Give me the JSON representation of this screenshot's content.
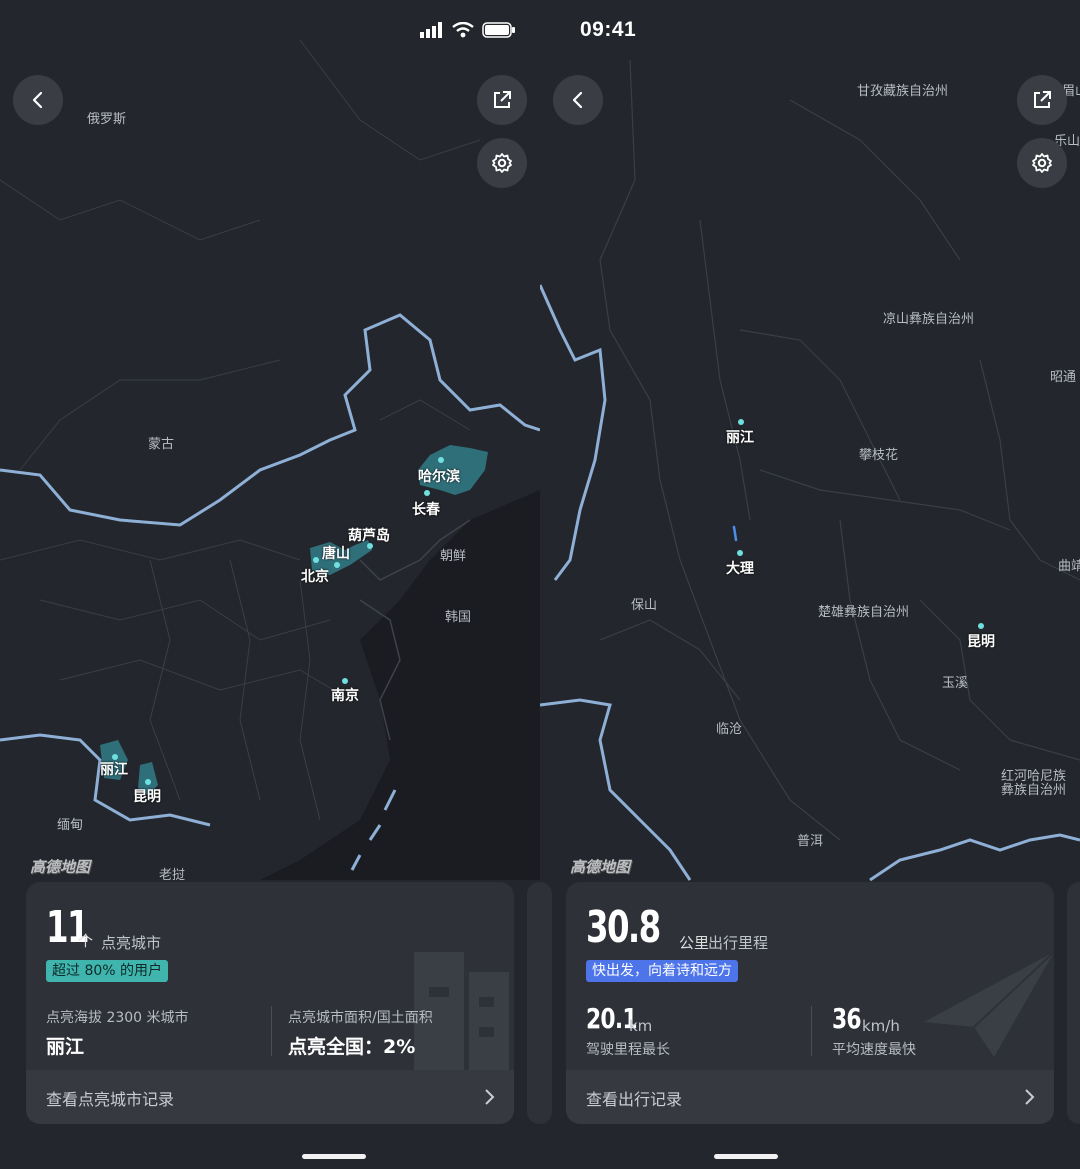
{
  "status": {
    "time": "09:41"
  },
  "watermark": "高德地图",
  "left": {
    "map_labels": {
      "russia": "俄罗斯",
      "mongolia": "蒙古",
      "north_korea": "朝鲜",
      "south_korea": "韩国",
      "myanmar": "缅甸",
      "laos": "老挝"
    },
    "cities": {
      "harbin": "哈尔滨",
      "changchun": "长春",
      "huludao": "葫芦岛",
      "tangshan": "唐山",
      "beijing": "北京",
      "nanjing": "南京",
      "lijiang": "丽江",
      "kunming": "昆明"
    },
    "card": {
      "count": "11",
      "count_unit": "个",
      "count_label": "点亮城市",
      "badge": "超过 80% 的用户",
      "stat1_label": "点亮海拔 2300 米城市",
      "stat1_value": "丽江",
      "stat2_label": "点亮城市面积/国土面积",
      "stat2_value": "点亮全国：2%",
      "footer": "查看点亮城市记录"
    }
  },
  "right": {
    "map_labels": {
      "ganzi": "甘孜藏族自治州",
      "leshan": "乐山",
      "liangshan": "凉山彝族自治州",
      "zhaotong": "昭通",
      "panzhihua": "攀枝花",
      "baoshan": "保山",
      "chuxiong": "楚雄彝族自治州",
      "qujing": "曲靖",
      "yuxi": "玉溪",
      "lincang": "临沧",
      "honghe1": "红河哈尼族",
      "honghe2": "彝族自治州",
      "puer": "普洱",
      "partial_top": "眉山"
    },
    "cities": {
      "lijiang": "丽江",
      "dali": "大理",
      "kunming": "昆明"
    },
    "card": {
      "distance": "30.8",
      "distance_unit": "公里",
      "distance_label": "出行里程",
      "badge": "快出发，向着诗和远方",
      "stat1_num": "20.1",
      "stat1_unit": "km",
      "stat1_label": "驾驶里程最长",
      "stat2_num": "36",
      "stat2_unit": "km/h",
      "stat2_label": "平均速度最快",
      "footer": "查看出行记录"
    }
  },
  "colors": {
    "background": "#202328",
    "card": "#2e3138",
    "border_line": "#8fb0d6",
    "highlight_region": "#2f6f7a",
    "badge_teal": "#3fb5ad",
    "badge_blue": "#4d74e8",
    "city_dot": "#6fe0e0"
  },
  "icons": [
    "signal-icon",
    "wifi-icon",
    "battery-icon",
    "back-icon",
    "share-icon",
    "settings-icon",
    "chevron-right-icon",
    "paper-plane-icon",
    "building-icon"
  ]
}
